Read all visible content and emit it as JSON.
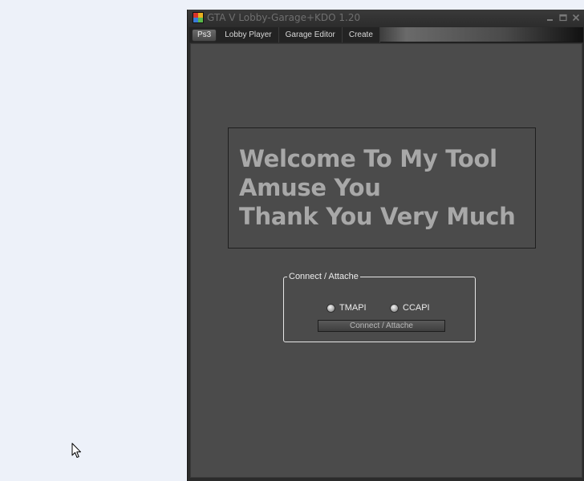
{
  "window": {
    "title": "GTA V Lobby-Garage+KDO 1.20"
  },
  "menu": {
    "items": [
      {
        "label": "Ps3",
        "active": true
      },
      {
        "label": "Lobby Player",
        "active": false
      },
      {
        "label": "Garage Editor",
        "active": false
      },
      {
        "label": "Create",
        "active": false
      }
    ]
  },
  "welcome": {
    "lines": [
      "Welcome To My Tool",
      "Amuse You",
      "Thank You Very Much"
    ]
  },
  "connect": {
    "group_title": "Connect / Attache",
    "options": [
      {
        "label": "TMAPI",
        "selected": false
      },
      {
        "label": "CCAPI",
        "selected": false
      }
    ],
    "button_label": "Connect / Attache"
  },
  "colors": {
    "desktop": "#edf1f9",
    "window_frame": "#2b2b2b",
    "client_bg": "#4b4b4b",
    "welcome_text": "#a8a8a8",
    "title_text": "#6f6f6f"
  },
  "icons": {
    "app": "app-icon",
    "minimize": "minimize-icon",
    "maximize": "maximize-icon",
    "close": "close-icon",
    "cursor": "mouse-pointer-icon"
  }
}
